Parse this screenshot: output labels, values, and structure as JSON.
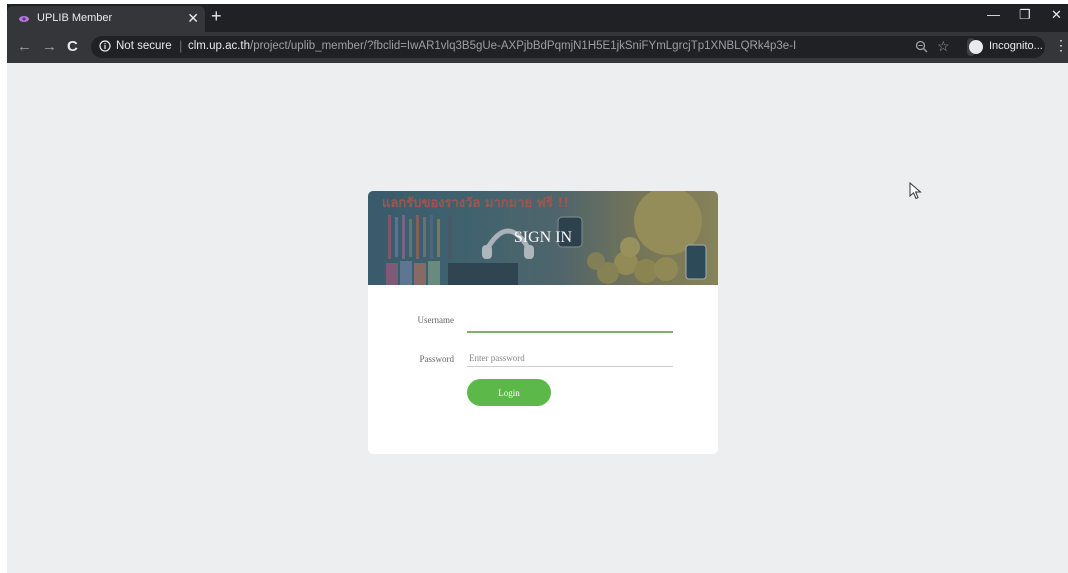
{
  "browser": {
    "tab": {
      "title": "UPLIB Member"
    },
    "address": {
      "security_label": "Not secure",
      "host": "clm.up.ac.th",
      "path": "/project/uplib_member/?fbclid=IwAR1vlq3B5gUe-AXPjbBdPqmjN1H5E1jkSniFYmLgrcjTp1XNBLQRk4p3e-I"
    },
    "profile": {
      "label": "Incognito..."
    }
  },
  "card": {
    "title": "SIGN IN",
    "banner_text": "แลกรับของรางวัล มากมาย ฟรี !!"
  },
  "form": {
    "username_label": "Username",
    "username_value": "",
    "password_label": "Password",
    "password_placeholder": "Enter password",
    "login_label": "Login"
  },
  "colors": {
    "login_button": "#5cb848",
    "username_underline": "#7faf6f",
    "page_background": "#eceeef"
  }
}
